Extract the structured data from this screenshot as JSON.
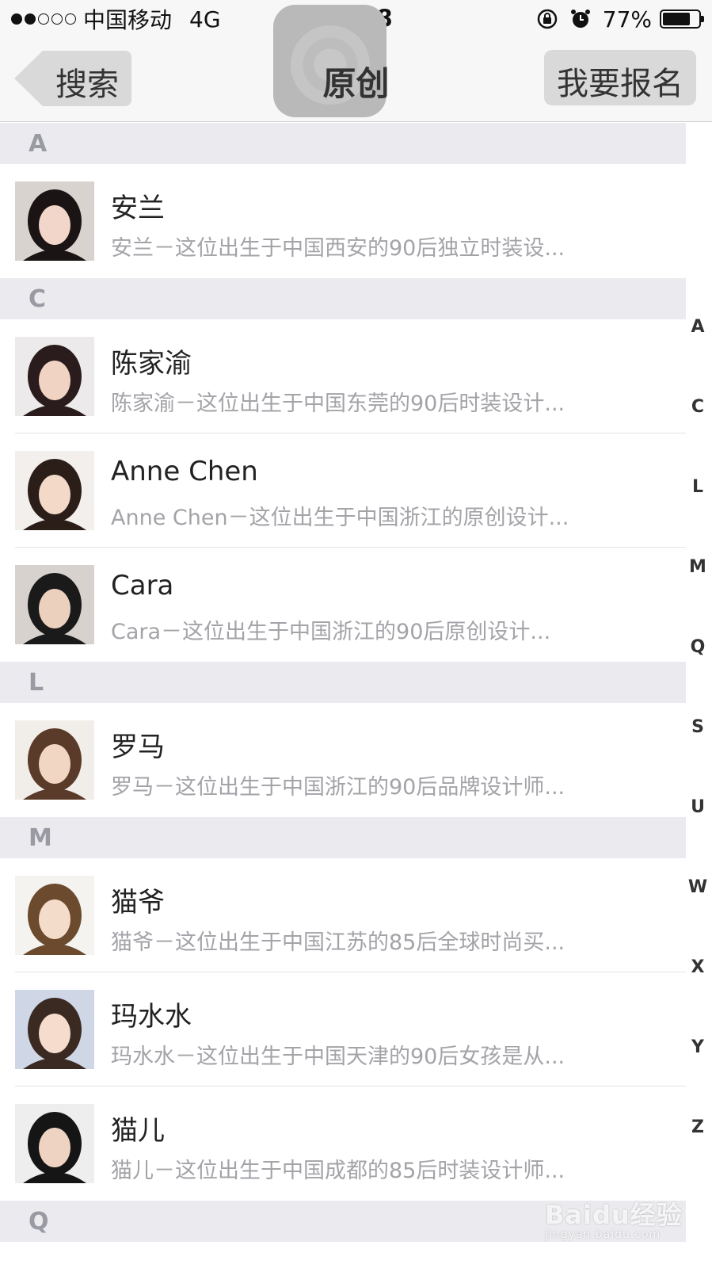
{
  "status_bar": {
    "signal_dots": [
      true,
      true,
      false,
      false,
      false
    ],
    "carrier": "中国移动",
    "network": "4G",
    "time": "12:08",
    "battery_percent": "77%",
    "battery_level": 0.77
  },
  "nav": {
    "back_label": "搜索",
    "title": "原创",
    "action_label": "我要报名"
  },
  "sections": [
    {
      "letter": "A",
      "items": [
        {
          "name": "安兰",
          "desc": "安兰－这位出生于中国西安的90后独立时装设..."
        }
      ]
    },
    {
      "letter": "C",
      "items": [
        {
          "name": "陈家渝",
          "desc": "陈家渝－这位出生于中国东莞的90后时装设计..."
        },
        {
          "name": "Anne Chen",
          "desc": "Anne Chen－这位出生于中国浙江的原创设计..."
        },
        {
          "name": "Cara",
          "desc": "Cara－这位出生于中国浙江的90后原创设计..."
        }
      ]
    },
    {
      "letter": "L",
      "items": [
        {
          "name": "罗马",
          "desc": "罗马－这位出生于中国浙江的90后品牌设计师..."
        }
      ]
    },
    {
      "letter": "M",
      "items": [
        {
          "name": "猫爷",
          "desc": "猫爷－这位出生于中国江苏的85后全球时尚买..."
        },
        {
          "name": "玛水水",
          "desc": "玛水水－这位出生于中国天津的90后女孩是从..."
        },
        {
          "name": "猫儿",
          "desc": "猫儿－这位出生于中国成都的85后时装设计师..."
        }
      ]
    },
    {
      "letter": "Q",
      "items": []
    }
  ],
  "index_letters": [
    "A",
    "C",
    "L",
    "M",
    "Q",
    "S",
    "U",
    "W",
    "X",
    "Y",
    "Z"
  ],
  "watermark": {
    "text": "Baidu经验",
    "sub": "jingyan.baidu.com"
  }
}
